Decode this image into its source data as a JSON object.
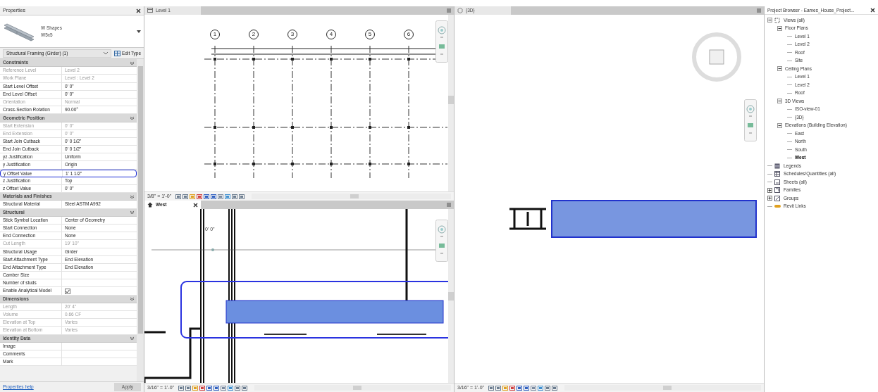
{
  "properties": {
    "title": "Properties",
    "type_family": "W Shapes",
    "type_name": "W5x5",
    "selector": "Structural Framing (Girder) (1)",
    "edit_type": "Edit Type",
    "groups": [
      {
        "name": "Constraints",
        "rows": [
          {
            "label": "Reference Level",
            "value": "Level 2",
            "disabled": true,
            "highlighted": false
          },
          {
            "label": "Work Plane",
            "value": "Level : Level 2",
            "disabled": true,
            "highlighted": false
          },
          {
            "label": "Start Level Offset",
            "value": "0' 0\"",
            "disabled": false,
            "highlighted": false
          },
          {
            "label": "End Level Offset",
            "value": "0' 0\"",
            "disabled": false,
            "highlighted": false
          },
          {
            "label": "Orientation",
            "value": "Normal",
            "disabled": true,
            "highlighted": false
          },
          {
            "label": "Cross-Section Rotation",
            "value": "90.00°",
            "disabled": false,
            "highlighted": false
          }
        ]
      },
      {
        "name": "Geometric Position",
        "rows": [
          {
            "label": "Start Extension",
            "value": "0' 0\"",
            "disabled": true,
            "highlighted": false
          },
          {
            "label": "End Extension",
            "value": "0' 0\"",
            "disabled": true,
            "highlighted": false
          },
          {
            "label": "Start Join Cutback",
            "value": "0' 0 1/2\"",
            "disabled": false,
            "highlighted": false
          },
          {
            "label": "End Join Cutback",
            "value": "0' 0 1/2\"",
            "disabled": false,
            "highlighted": false
          },
          {
            "label": "yz Justification",
            "value": "Uniform",
            "disabled": false,
            "highlighted": false
          },
          {
            "label": "y Justification",
            "value": "Origin",
            "disabled": false,
            "highlighted": false
          },
          {
            "label": "y Offset Value",
            "value": "1' 1 1/2\"",
            "disabled": false,
            "highlighted": true
          },
          {
            "label": "z Justification",
            "value": "Top",
            "disabled": false,
            "highlighted": false
          },
          {
            "label": "z Offset Value",
            "value": "0' 0\"",
            "disabled": false,
            "highlighted": false
          }
        ]
      },
      {
        "name": "Materials and Finishes",
        "rows": [
          {
            "label": "Structural Material",
            "value": "Steel ASTM A992",
            "disabled": false,
            "highlighted": false
          }
        ]
      },
      {
        "name": "Structural",
        "rows": [
          {
            "label": "Stick Symbol Location",
            "value": "Center of Geometry",
            "disabled": false,
            "highlighted": false
          },
          {
            "label": "Start Connection",
            "value": "None",
            "disabled": false,
            "highlighted": false
          },
          {
            "label": "End Connection",
            "value": "None",
            "disabled": false,
            "highlighted": false
          },
          {
            "label": "Cut Length",
            "value": "19' 10\"",
            "disabled": true,
            "highlighted": false
          },
          {
            "label": "Structural Usage",
            "value": "Girder",
            "disabled": false,
            "highlighted": false
          },
          {
            "label": "Start Attachment Type",
            "value": "End Elevation",
            "disabled": false,
            "highlighted": false
          },
          {
            "label": "End Attachment Type",
            "value": "End Elevation",
            "disabled": false,
            "highlighted": false
          },
          {
            "label": "Camber Size",
            "disabled": false,
            "highlighted": false
          },
          {
            "label": "Number of studs",
            "disabled": false,
            "highlighted": false
          },
          {
            "label": "Enable Analytical Model",
            "kind": "checkbox",
            "checked": true,
            "disabled": false,
            "highlighted": false
          }
        ]
      },
      {
        "name": "Dimensions",
        "rows": [
          {
            "label": "Length",
            "value": "20' 4\"",
            "disabled": true,
            "highlighted": false
          },
          {
            "label": "Volume",
            "value": "0.66 CF",
            "disabled": true,
            "highlighted": false
          },
          {
            "label": "Elevation at Top",
            "value": "Varies",
            "disabled": true,
            "highlighted": false
          },
          {
            "label": "Elevation at Bottom",
            "value": "Varies",
            "disabled": true,
            "highlighted": false
          }
        ]
      },
      {
        "name": "Identity Data",
        "rows": [
          {
            "label": "Image",
            "disabled": false,
            "highlighted": false
          },
          {
            "label": "Comments",
            "disabled": false,
            "highlighted": false
          },
          {
            "label": "Mark",
            "disabled": false,
            "highlighted": false
          }
        ]
      }
    ],
    "help_link": "Properties help",
    "apply": "Apply"
  },
  "views": [
    {
      "kind": "plan",
      "title": "Level 1",
      "closable": false,
      "grid_bubbles": [
        "1",
        "2",
        "3",
        "4",
        "5",
        "6"
      ],
      "scale": "3/8\" = 1'-0\""
    },
    {
      "kind": "elevation",
      "title": "West",
      "closable": true,
      "level_label": "0' 0\"",
      "scale": "3/16\" = 1'-0\""
    },
    {
      "kind": "perspective",
      "title": "{3D}",
      "closable": false,
      "scale": "3/16\" = 1'-0\""
    }
  ],
  "project_browser": {
    "title": "Project Browser - Eames_House_Project...",
    "tree": [
      {
        "label": "Views (all)",
        "expanded": true,
        "selected": false,
        "children": [
          {
            "label": "Floor Plans",
            "expanded": true,
            "selected": false,
            "children": [
              {
                "label": "Level 1",
                "selected": false
              },
              {
                "label": "Level 2",
                "selected": false
              },
              {
                "label": "Roof",
                "selected": false
              },
              {
                "label": "Site",
                "selected": false
              }
            ]
          },
          {
            "label": "Ceiling Plans",
            "expanded": true,
            "selected": false,
            "children": [
              {
                "label": "Level 1",
                "selected": false
              },
              {
                "label": "Level 2",
                "selected": false
              },
              {
                "label": "Roof",
                "selected": false
              }
            ]
          },
          {
            "label": "3D Views",
            "expanded": true,
            "selected": false,
            "children": [
              {
                "label": "ISO-view-01",
                "selected": false
              },
              {
                "label": "{3D}",
                "selected": false
              }
            ]
          },
          {
            "label": "Elevations (Building Elevation)",
            "expanded": true,
            "selected": false,
            "children": [
              {
                "label": "East",
                "selected": false
              },
              {
                "label": "North",
                "selected": false
              },
              {
                "label": "South",
                "selected": false
              },
              {
                "label": "West",
                "selected": true
              }
            ]
          }
        ]
      },
      {
        "label": "Legends",
        "selected": false
      },
      {
        "label": "Schedules/Quantities (all)",
        "selected": false
      },
      {
        "label": "Sheets (all)",
        "selected": false
      },
      {
        "label": "Families",
        "expanded": false,
        "selected": false
      },
      {
        "label": "Groups",
        "expanded": false,
        "selected": false
      },
      {
        "label": "Revit Links",
        "selected": false
      }
    ]
  }
}
